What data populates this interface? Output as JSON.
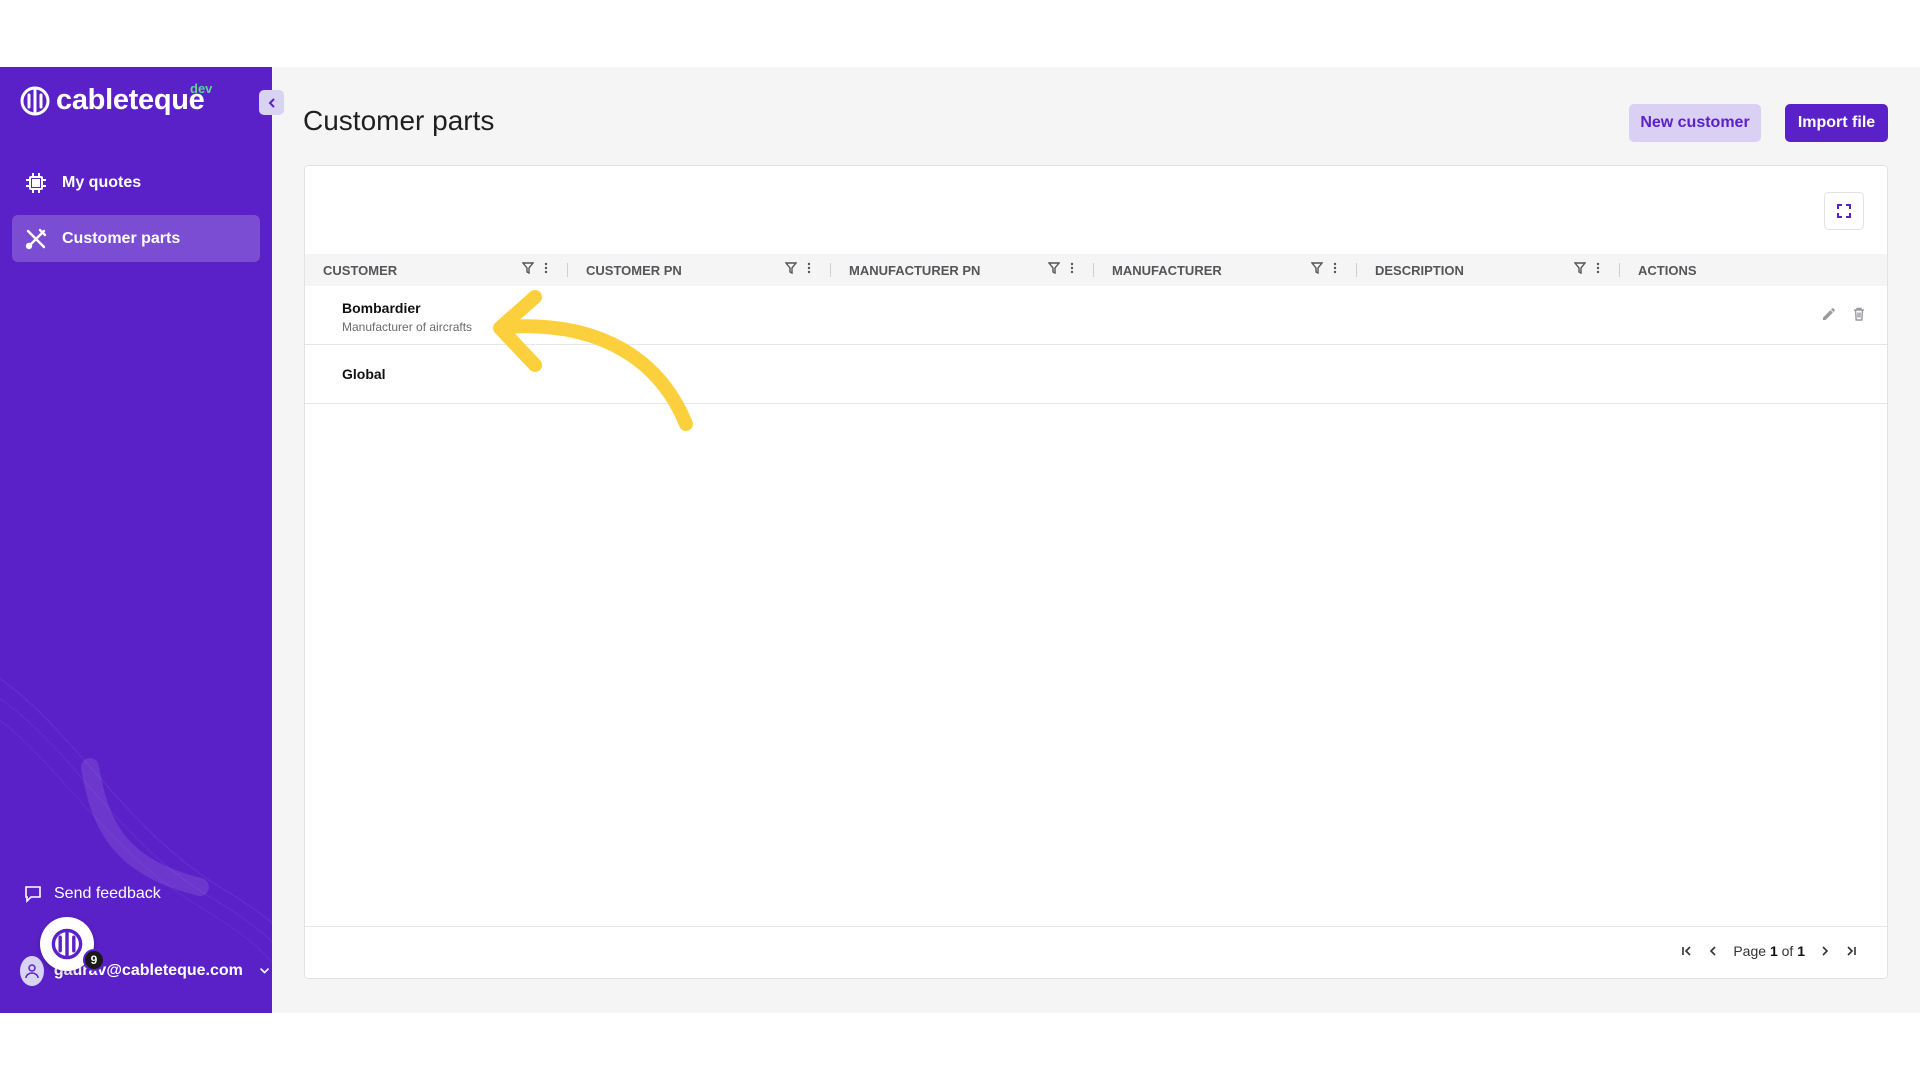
{
  "app": {
    "brand": "cableteque",
    "env_tag": "dev",
    "accent_color": "#5b21c8",
    "annotation_color": "#fcd03c"
  },
  "sidebar": {
    "items": [
      {
        "label": "My quotes",
        "icon": "cpu-chip-icon",
        "active": false
      },
      {
        "label": "Customer parts",
        "icon": "tools-icon",
        "active": true
      }
    ],
    "feedback_label": "Send feedback",
    "user_email": "gaurav@cableteque.com",
    "notification_count": "9"
  },
  "header": {
    "title": "Customer parts",
    "new_customer_label": "New customer",
    "import_file_label": "Import file"
  },
  "table": {
    "columns": [
      "CUSTOMER",
      "CUSTOMER PN",
      "MANUFACTURER PN",
      "MANUFACTURER",
      "DESCRIPTION",
      "ACTIONS"
    ],
    "rows": [
      {
        "customer": "Bombardier",
        "description": "Manufacturer of aircrafts"
      },
      {
        "customer": "Global",
        "description": ""
      }
    ]
  },
  "pagination": {
    "page_label": "Page",
    "current": "1",
    "of_label": "of",
    "total": "1"
  }
}
